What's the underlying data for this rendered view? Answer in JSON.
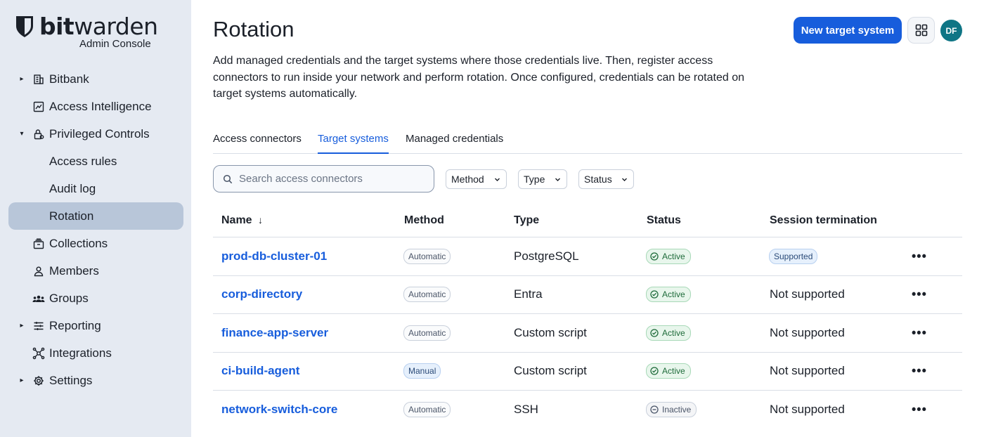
{
  "brand": {
    "name_bold": "bit",
    "name_light": "warden",
    "subtitle": "Admin Console"
  },
  "sidebar": {
    "items": [
      {
        "label": "Bitbank",
        "caret": "▸",
        "icon": "building-icon"
      },
      {
        "label": "Access Intelligence",
        "caret": "",
        "icon": "chart-icon"
      },
      {
        "label": "Privileged Controls",
        "caret": "▾",
        "icon": "lock-icon"
      },
      {
        "label": "Access rules",
        "caret": "",
        "icon": ""
      },
      {
        "label": "Audit log",
        "caret": "",
        "icon": ""
      },
      {
        "label": "Rotation",
        "caret": "",
        "icon": "",
        "active": true
      },
      {
        "label": "Collections",
        "caret": "",
        "icon": "collections-icon"
      },
      {
        "label": "Members",
        "caret": "",
        "icon": "user-icon"
      },
      {
        "label": "Groups",
        "caret": "",
        "icon": "users-icon"
      },
      {
        "label": "Reporting",
        "caret": "▸",
        "icon": "sliders-icon"
      },
      {
        "label": "Integrations",
        "caret": "",
        "icon": "integrations-icon"
      },
      {
        "label": "Settings",
        "caret": "▸",
        "icon": "gear-icon"
      }
    ]
  },
  "header": {
    "title": "Rotation",
    "description": "Add managed credentials and the target systems where those credentials live. Then, register access connectors to run inside your network and perform rotation. Once configured, credentials can be rotated on target systems automatically.",
    "new_button": "New target system",
    "avatar_initials": "DF"
  },
  "tabs": [
    {
      "label": "Access connectors",
      "active": false
    },
    {
      "label": "Target systems",
      "active": true
    },
    {
      "label": "Managed credentials",
      "active": false
    }
  ],
  "filters": {
    "search_placeholder": "Search access connectors",
    "method": "Method",
    "type": "Type",
    "status": "Status"
  },
  "table": {
    "columns": [
      "Name",
      "Method",
      "Type",
      "Status",
      "Session termination"
    ],
    "sort_indicator": "↓",
    "rows": [
      {
        "name": "prod-db-cluster-01",
        "method": "Automatic",
        "type": "PostgreSQL",
        "status": "Active",
        "session": "Supported"
      },
      {
        "name": "corp-directory",
        "method": "Automatic",
        "type": "Entra",
        "status": "Active",
        "session": "Not supported"
      },
      {
        "name": "finance-app-server",
        "method": "Automatic",
        "type": "Custom script",
        "status": "Active",
        "session": "Not supported"
      },
      {
        "name": "ci-build-agent",
        "method": "Manual",
        "type": "Custom script",
        "status": "Active",
        "session": "Not supported"
      },
      {
        "name": "network-switch-core",
        "method": "Automatic",
        "type": "SSH",
        "status": "Inactive",
        "session": "Not supported"
      }
    ],
    "row_menu": "•••"
  },
  "colors": {
    "accent": "#175ddc",
    "sidebar_bg": "#e5eaf2",
    "sidebar_active": "#b8c6d9",
    "avatar": "#0f7585"
  }
}
